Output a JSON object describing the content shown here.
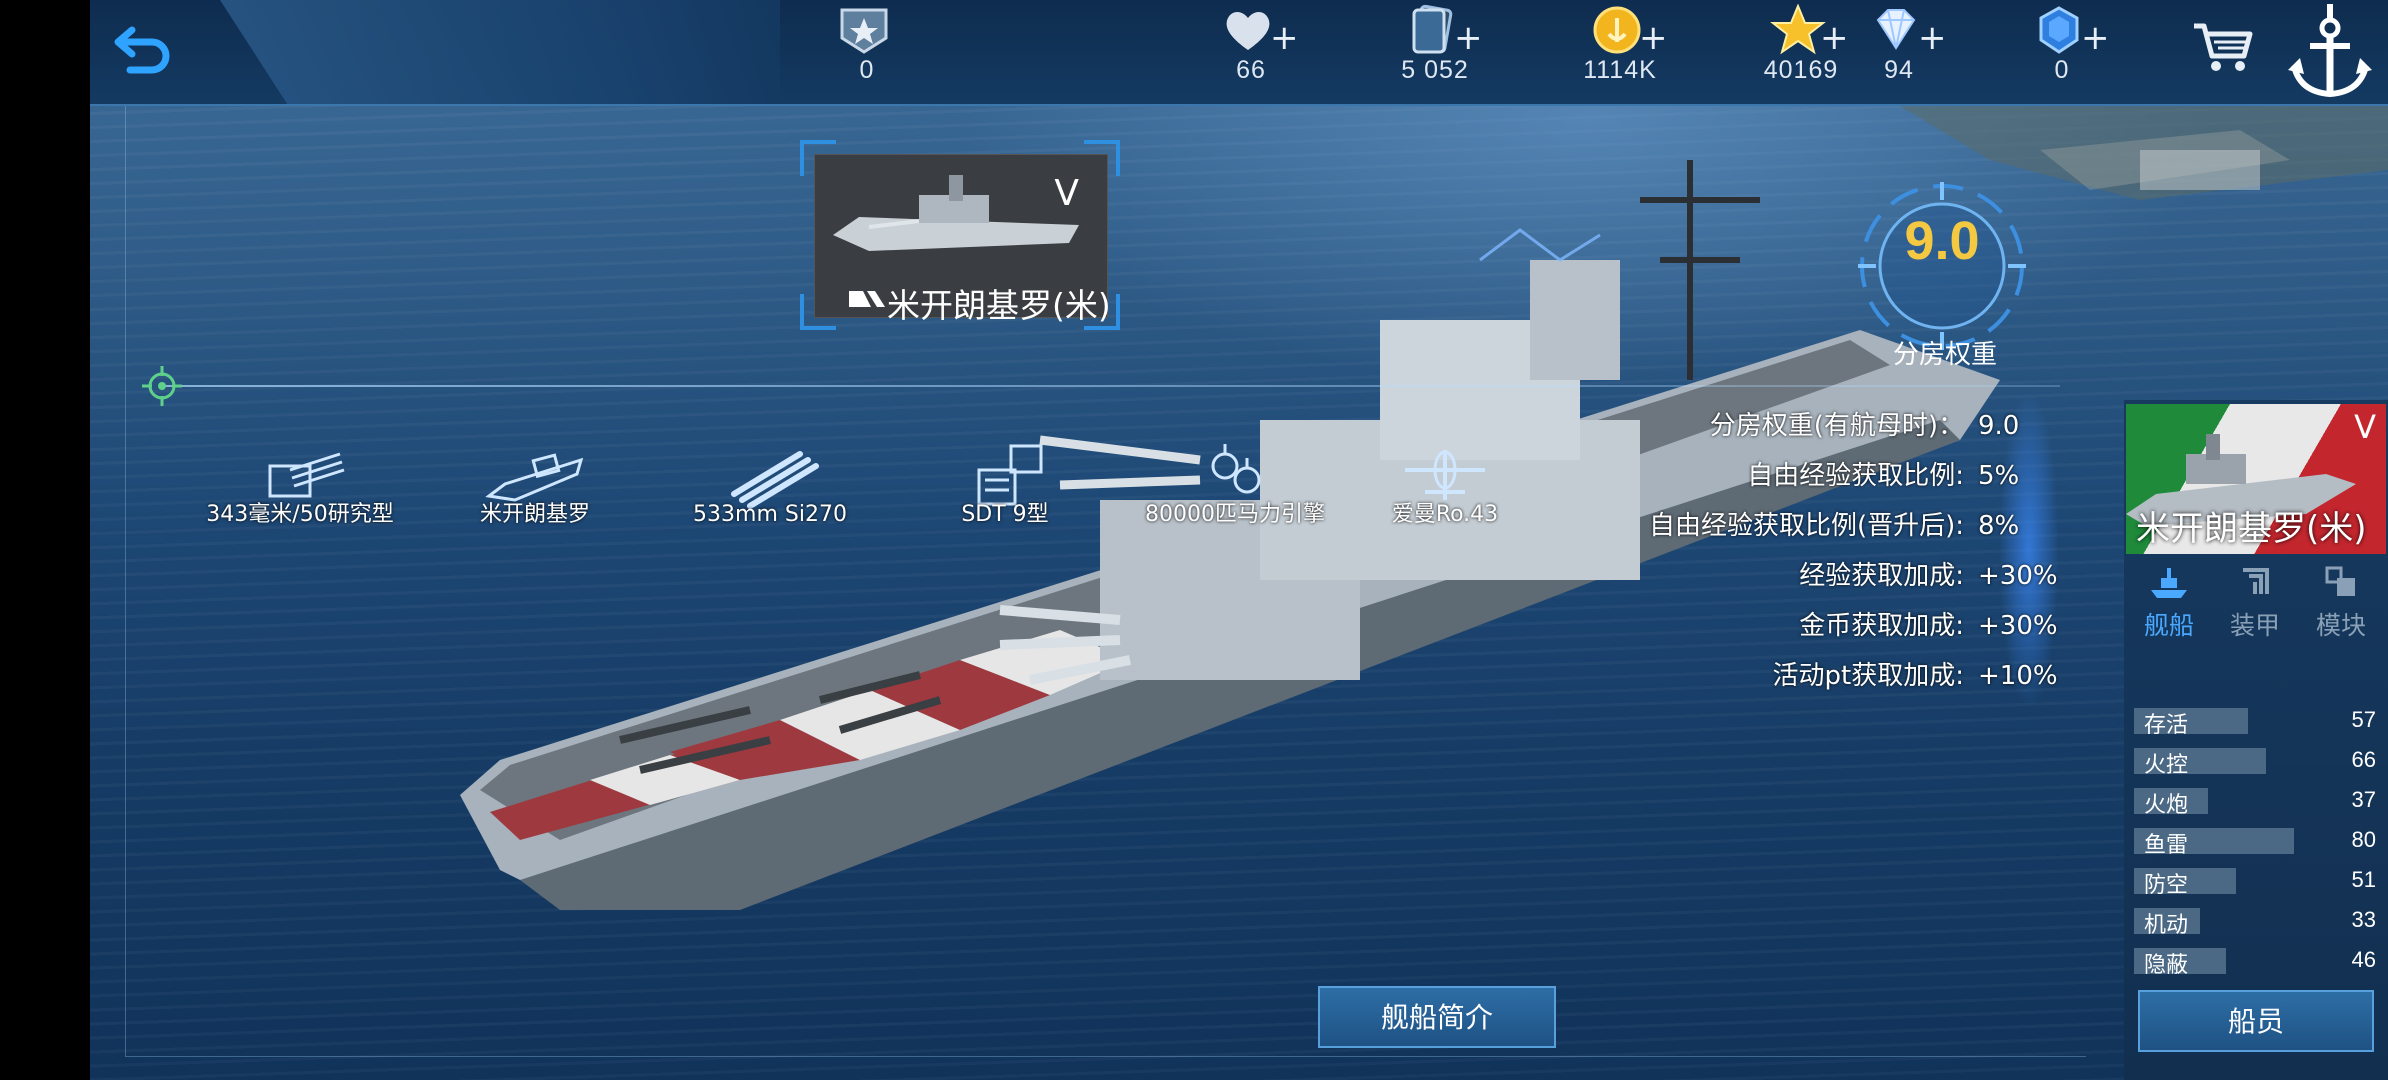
{
  "topbar": {
    "resources": [
      {
        "name": "rank",
        "icon": "rank-badge-icon",
        "value": "0",
        "plus": false
      },
      {
        "name": "hearts",
        "icon": "heart-icon",
        "value": "66",
        "plus": true
      },
      {
        "name": "cards",
        "icon": "card-icon",
        "value": "5 052",
        "plus": true
      },
      {
        "name": "coins",
        "icon": "gold-coin-icon",
        "value": "1114K",
        "plus": true
      },
      {
        "name": "stars",
        "icon": "star-icon",
        "value": "40169",
        "plus": true
      },
      {
        "name": "diamonds",
        "icon": "diamond-icon",
        "value": "94",
        "plus": true
      },
      {
        "name": "gems",
        "icon": "blue-gem-icon",
        "value": "0",
        "plus": true
      }
    ],
    "plus_label": "+"
  },
  "ship_card": {
    "tier": "V",
    "name": "米开朗基罗(米)"
  },
  "matchmaking": {
    "value": "9.0",
    "label": "分房权重"
  },
  "modules": [
    {
      "label": "343毫米/50研究型",
      "icon": "main-gun-turret-icon"
    },
    {
      "label": "米开朗基罗",
      "icon": "hull-icon"
    },
    {
      "label": "533mm Si270",
      "icon": "torpedo-icon"
    },
    {
      "label": "SDT 9型",
      "icon": "fire-control-icon"
    },
    {
      "label": "80000匹马力引擎",
      "icon": "engine-icon"
    },
    {
      "label": "爱曼Ro.43",
      "icon": "aircraft-icon"
    }
  ],
  "ship_stats": [
    {
      "label": "分房权重(有航母时)：",
      "value": "9.0"
    },
    {
      "label": "自由经验获取比例:",
      "value": "5%"
    },
    {
      "label": "自由经验获取比例(晋升后):",
      "value": "8%"
    },
    {
      "label": "经验获取加成:",
      "value": "+30%"
    },
    {
      "label": "金币获取加成:",
      "value": "+30%"
    },
    {
      "label": "活动pt获取加成:",
      "value": "+10%"
    }
  ],
  "side_panel": {
    "tier": "V",
    "name": "米开朗基罗(米)",
    "tabs": [
      {
        "label": "舰船",
        "icon": "ship-tab-icon",
        "active": true
      },
      {
        "label": "装甲",
        "icon": "armor-tab-icon",
        "active": false
      },
      {
        "label": "模块",
        "icon": "module-tab-icon",
        "active": false
      }
    ],
    "attributes": [
      {
        "label": "存活",
        "value": 57
      },
      {
        "label": "火控",
        "value": 66
      },
      {
        "label": "火炮",
        "value": 37
      },
      {
        "label": "鱼雷",
        "value": 80
      },
      {
        "label": "防空",
        "value": 51
      },
      {
        "label": "机动",
        "value": 33
      },
      {
        "label": "隐蔽",
        "value": 46
      }
    ],
    "crew_button": "船员"
  },
  "intro_button": "舰船简介",
  "colors": {
    "accent": "#2f8fe0",
    "gold": "#f5c842",
    "panel": "#163a60",
    "hull_stripe_red": "#9e3a3f"
  }
}
